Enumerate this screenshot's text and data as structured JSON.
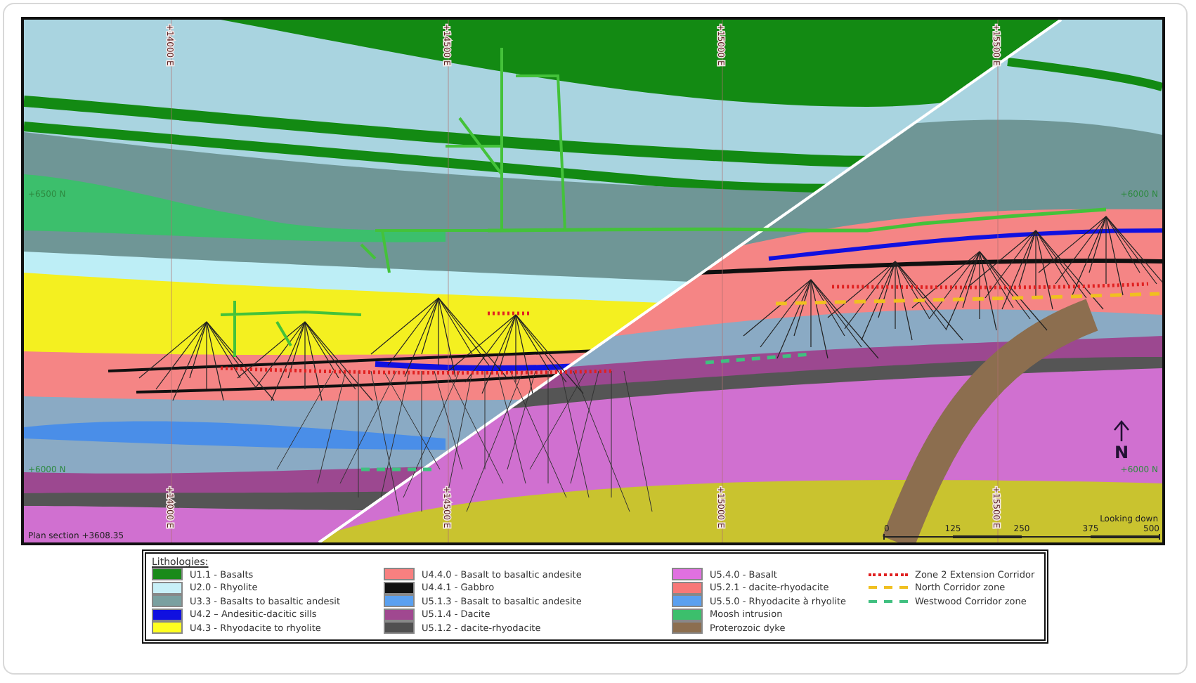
{
  "map": {
    "grid_labels_top": [
      "+14000 E",
      "+14500 E",
      "+15000 E",
      "+15500 E"
    ],
    "grid_labels_bottom": [
      "+14000 E",
      "+14500 E",
      "+15000 E",
      "+15500 E"
    ],
    "northing_labels_left": [
      "+6500 N",
      "+6000 N"
    ],
    "northing_labels_right": [
      "+6000 N",
      "+6000 N"
    ],
    "section_label": "Plan section +3608.35",
    "view_label": "Looking down",
    "north_label": "N",
    "scale_labels": [
      "0",
      "125",
      "250",
      "375",
      "500"
    ]
  },
  "legend": {
    "title": "Lithologies:",
    "columns": [
      [
        {
          "kind": "swatch",
          "label": "U1.1 - Basalts",
          "color": "#1a8a1a"
        },
        {
          "kind": "swatch",
          "label": "U2.0 - Rhyolite",
          "color": "#c8f0f8"
        },
        {
          "kind": "swatch",
          "label": "U3.3 - Basalts to basaltic andesit",
          "color": "#7aa0a0"
        },
        {
          "kind": "swatch",
          "label": "U4.2 – Andesitic-dacitic sills",
          "color": "#1010e0"
        },
        {
          "kind": "swatch",
          "label": "U4.3 - Rhyodacite to rhyolite",
          "color": "#ffff20"
        }
      ],
      [
        {
          "kind": "swatch",
          "label": "U4.4.0 - Basalt to basaltic andesite",
          "color": "#f88080"
        },
        {
          "kind": "swatch",
          "label": "U4.4.1 - Gabbro",
          "color": "#101010"
        },
        {
          "kind": "swatch",
          "label": "U5.1.3 - Basalt to basaltic andesite",
          "color": "#5aa0f0"
        },
        {
          "kind": "swatch",
          "label": "U5.1.4 - Dacite",
          "color": "#a04890"
        },
        {
          "kind": "swatch",
          "label": "U5.1.2 - dacite-rhyodacite",
          "color": "#505050"
        }
      ],
      [
        {
          "kind": "swatch",
          "label": "U5.4.0 - Basalt",
          "color": "#e070e0"
        },
        {
          "kind": "swatch",
          "label": "U5.2.1 - dacite-rhyodacite",
          "color": "#f87878"
        },
        {
          "kind": "swatch",
          "label": "U5.5.0 - Rhyodacite à rhyolite",
          "color": "#5aa0f0"
        },
        {
          "kind": "swatch",
          "label": "Moosh intrusion",
          "color": "#3cbf6c"
        },
        {
          "kind": "swatch",
          "label": "Proterozoic dyke",
          "color": "#8c6e4f"
        }
      ],
      [
        {
          "kind": "dotted",
          "label": "Zone 2 Extension Corridor",
          "color": "#e02020"
        },
        {
          "kind": "dashed",
          "label": "North Corridor zone",
          "color": "#f0c020"
        },
        {
          "kind": "dashed",
          "label": "Westwood Corridor zone",
          "color": "#40c080"
        }
      ]
    ]
  }
}
